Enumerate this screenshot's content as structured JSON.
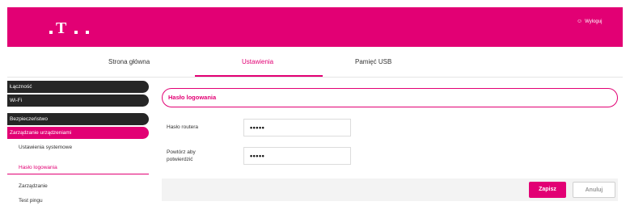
{
  "header": {
    "logo_letter": "T",
    "logout_icon": "user-icon",
    "logout_label": "Wyloguj"
  },
  "topnav": {
    "tabs": [
      {
        "label": "Strona główna"
      },
      {
        "label": "Ustawienia",
        "active": true
      },
      {
        "label": "Pamięć USB"
      }
    ]
  },
  "sidebar": {
    "items": [
      {
        "label": "Łączność"
      },
      {
        "label": "Wi-Fi"
      },
      {
        "label": "Bezpieczeństwo"
      },
      {
        "label": "Zarządzanie urządzeniami",
        "active": true
      }
    ],
    "subitems": [
      {
        "label": "Ustawienia systemowe"
      },
      {
        "label": "Hasło logowania",
        "active": true
      },
      {
        "label": "Zarządzanie"
      },
      {
        "label": "Test pingu"
      }
    ]
  },
  "main": {
    "section_title": "Hasło logowania",
    "fields": [
      {
        "label": "Hasło routera",
        "value": "•••••"
      },
      {
        "label_line1": "Powtórz aby",
        "label_line2": "potwierdzić",
        "value": "•••••"
      }
    ],
    "save_label": "Zapisz",
    "cancel_label": "Anuluj"
  },
  "colors": {
    "brand": "#e20074",
    "sidebar_dark": "#262626"
  }
}
